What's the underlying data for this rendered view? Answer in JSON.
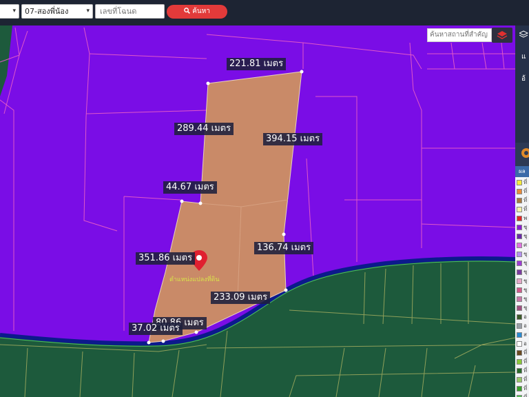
{
  "toolbar": {
    "province_caret": "▾",
    "district_value": "07-สองพี่น้อง",
    "district_caret": "▾",
    "deed_placeholder": "เลขที่โฉนด",
    "search_button": "ค้นหา",
    "search_icon": "magnifier-icon"
  },
  "map": {
    "place_search_placeholder": "ค้นหาสถานที่สำคัญ",
    "layer_icon": "layers-icon",
    "pin_caption": "ตำแหน่งแปลงที่ดิน",
    "colors": {
      "zone": "#7a0de6",
      "agri": "#1d5a3c",
      "parcel": "#c98a68",
      "road": "#0c1a8c",
      "gridline": "#e058c8"
    },
    "measurements": [
      {
        "text": "221.81 เมตร"
      },
      {
        "text": "289.44 เมตร"
      },
      {
        "text": "394.15 เมตร"
      },
      {
        "text": "44.67 เมตร"
      },
      {
        "text": "136.74 เมตร"
      },
      {
        "text": "351.86 เมตร"
      },
      {
        "text": "233.09 เมตร"
      },
      {
        "text": "80.86 เมตร"
      },
      {
        "text": "37.02 เมตร"
      }
    ]
  },
  "sidebar": {
    "legend_header": "ผล",
    "top_letters": [
      "แ",
      "อ้"
    ],
    "legend": [
      {
        "label": "ที่",
        "color": "#f5ea3a"
      },
      {
        "label": "ที่",
        "color": "#e88a3a"
      },
      {
        "label": "ที่",
        "color": "#a97840"
      },
      {
        "label": "ที่",
        "color": "#f7f1a8"
      },
      {
        "label": "พ",
        "color": "#e02828"
      },
      {
        "label": "ชุ",
        "color": "#8a1fd0"
      },
      {
        "label": "ชุ",
        "color": "#6a2aa8"
      },
      {
        "label": "ศ",
        "color": "#e070e0"
      },
      {
        "label": "ชุ",
        "color": "#b490f0"
      },
      {
        "label": "ชุ",
        "color": "#9d3ad6"
      },
      {
        "label": "ชุ",
        "color": "#7a3aa0"
      },
      {
        "label": "ชุ",
        "color": "#e4a8c8"
      },
      {
        "label": "ชุ",
        "color": "#d05a8a"
      },
      {
        "label": "ชุ",
        "color": "#c878a8"
      },
      {
        "label": "ชุ",
        "color": "#a05080"
      },
      {
        "label": "อ",
        "color": "#3c5a2a"
      },
      {
        "label": "อ",
        "color": "#9aa0a8"
      },
      {
        "label": "ส",
        "color": "#2a8ad0"
      },
      {
        "label": "อ",
        "color": "#ffffff"
      },
      {
        "label": "ที่",
        "color": "#6a4a20"
      },
      {
        "label": "ที่",
        "color": "#8ac83a"
      },
      {
        "label": "ที่",
        "color": "#2a6a2a"
      },
      {
        "label": "ที่",
        "color": "#9ac86a"
      },
      {
        "label": "ที่",
        "color": "#3aa02a"
      },
      {
        "label": "ที่",
        "color": "#5ac05a"
      },
      {
        "label": "ที่",
        "color": "#a0c8e0"
      }
    ]
  }
}
